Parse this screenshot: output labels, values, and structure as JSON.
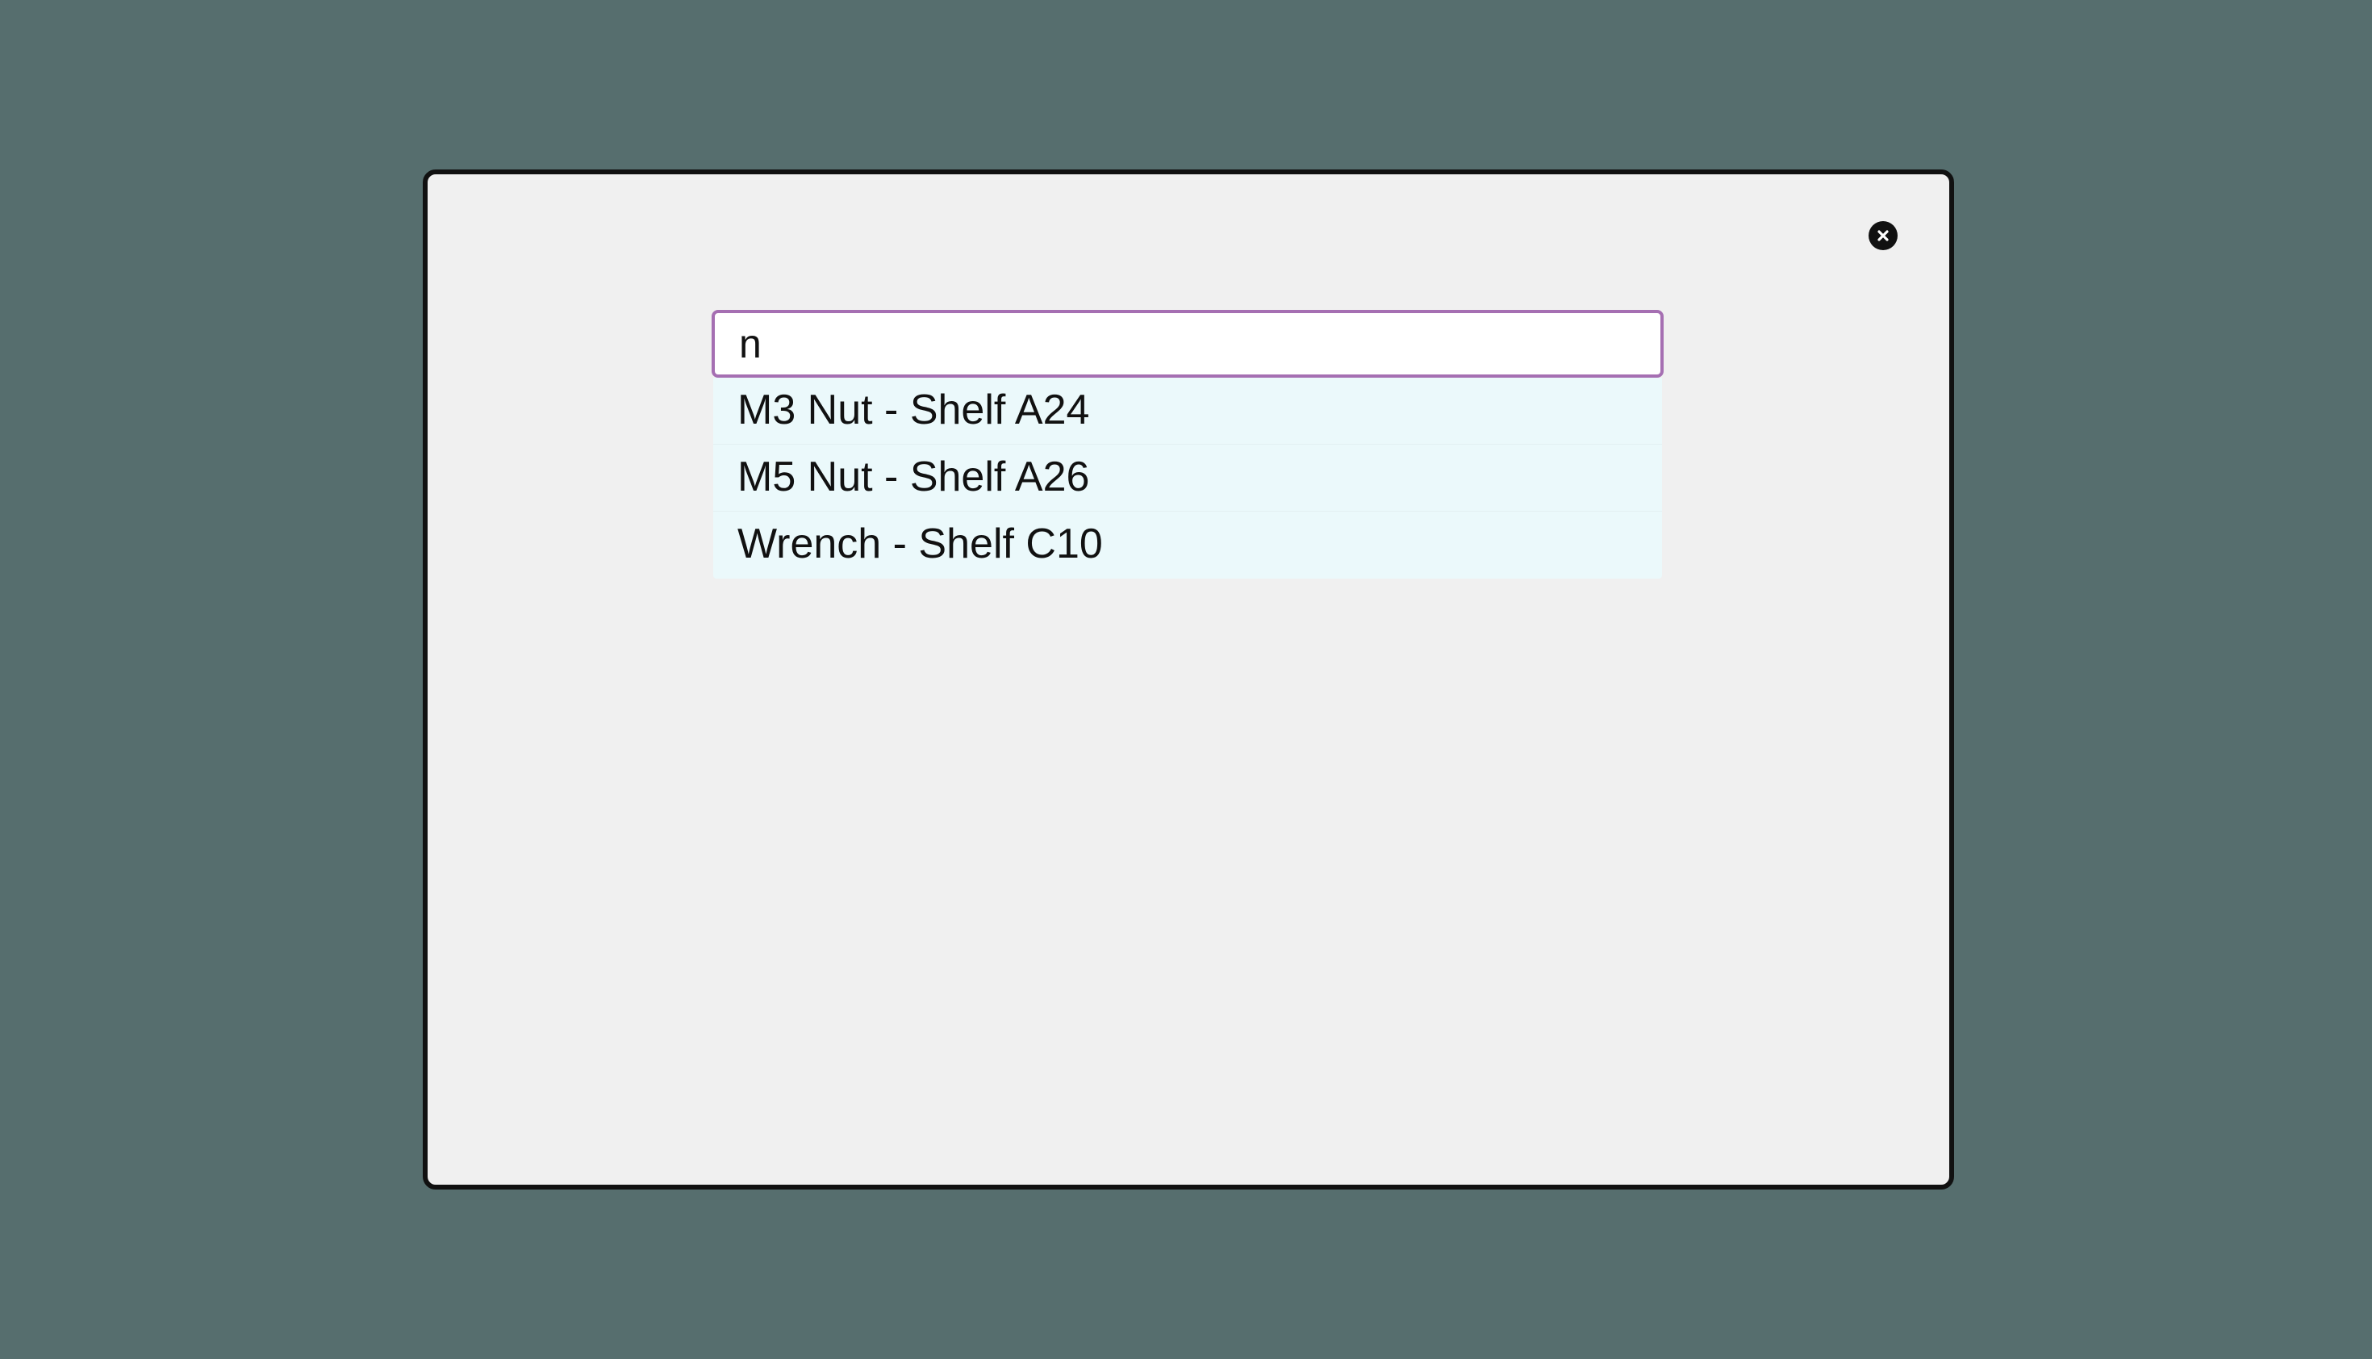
{
  "dialog": {
    "close_icon": "close-circle-icon"
  },
  "search": {
    "value": "n",
    "border_color": "#a56fb2"
  },
  "suggestions": [
    {
      "label": "M3 Nut - Shelf A24"
    },
    {
      "label": "M5 Nut - Shelf A26"
    },
    {
      "label": "Wrench - Shelf C10"
    }
  ],
  "colors": {
    "background": "#566e6e",
    "dialog_background": "#f0f0f0",
    "suggestion_background": "#ebf9fb"
  }
}
